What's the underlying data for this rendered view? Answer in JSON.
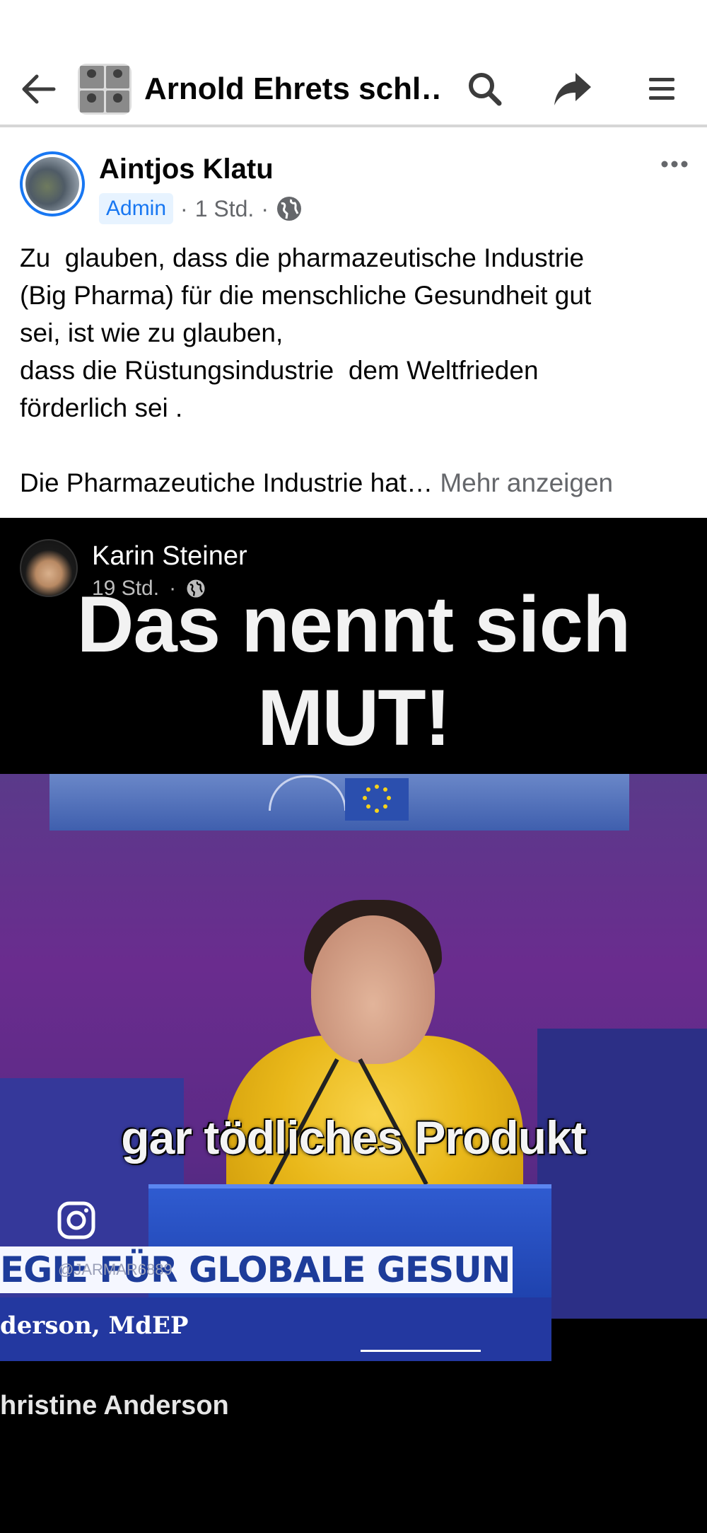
{
  "header": {
    "group_title": "Arnold Ehrets  schl…",
    "back_icon": "arrow-left-icon",
    "search_icon": "search-icon",
    "share_icon": "share-icon",
    "menu_icon": "hamburger-menu-icon"
  },
  "post": {
    "author": "Aintjos Klatu",
    "badge": "Admin",
    "time": "1 Std.",
    "separator": "·",
    "privacy_icon": "globe-icon",
    "more_icon": "more-horizontal-icon",
    "lines": [
      "Zu  glauben, dass die pharmazeutische Industrie",
      "(Big Pharma) für die menschliche Gesundheit gut",
      "sei, ist wie zu glauben,",
      "dass die Rüstungsindustrie  dem Weltfrieden",
      "förderlich sei ."
    ],
    "teaser": "Die Pharmazeutiche Industrie hat… ",
    "see_more": "Mehr anzeigen"
  },
  "shared": {
    "author": "Karin Steiner",
    "time": "19 Std.",
    "dot": "·",
    "headline_1": "Das nennt sich",
    "headline_2": "MUT!",
    "subtitle": "gar tödliches Produkt",
    "lower_third": "EGIE FÜR GLOBALE GESUNDHEIT",
    "watermark": "@JARMAR6889",
    "lower_name": "derson, MdEP",
    "caption_name": "hristine Anderson"
  },
  "colors": {
    "accent": "#1877f2",
    "muted": "#65676b",
    "badge_bg": "#e7f3ff"
  }
}
